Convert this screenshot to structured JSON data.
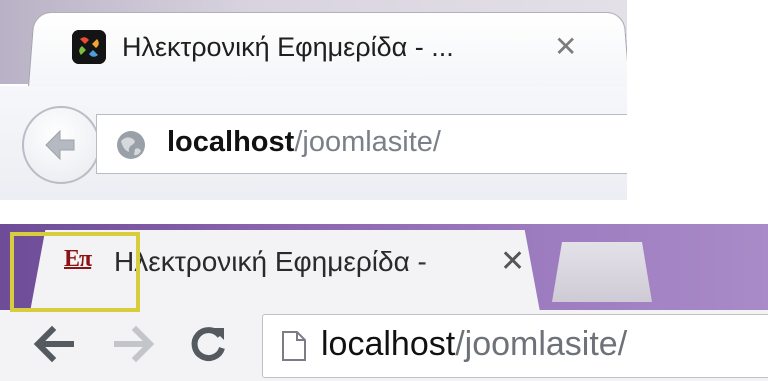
{
  "browser_old": {
    "tab": {
      "favicon": "joomla-logo-icon",
      "title": "Ηλεκτρονική Εφημερίδα - ...",
      "close": "✕"
    },
    "toolbar": {
      "back_icon": "back-arrow-icon",
      "site_icon": "globe-icon",
      "url_host": "localhost",
      "url_path": "/joomlasite/"
    }
  },
  "browser_new": {
    "tab": {
      "favicon_text": "Επ",
      "title": "Ηλεκτρονική Εφημερίδα -",
      "close": "✕"
    },
    "toolbar": {
      "back_icon": "back-arrow-icon",
      "forward_icon": "forward-arrow-icon",
      "reload_icon": "reload-icon",
      "page_icon": "page-icon",
      "url_host": "localhost",
      "url_path": "/joomlasite/"
    }
  },
  "colors": {
    "highlight": "#d8cd3c",
    "theme_purple": "#8a63ad",
    "favicon_red": "#8c1313"
  }
}
